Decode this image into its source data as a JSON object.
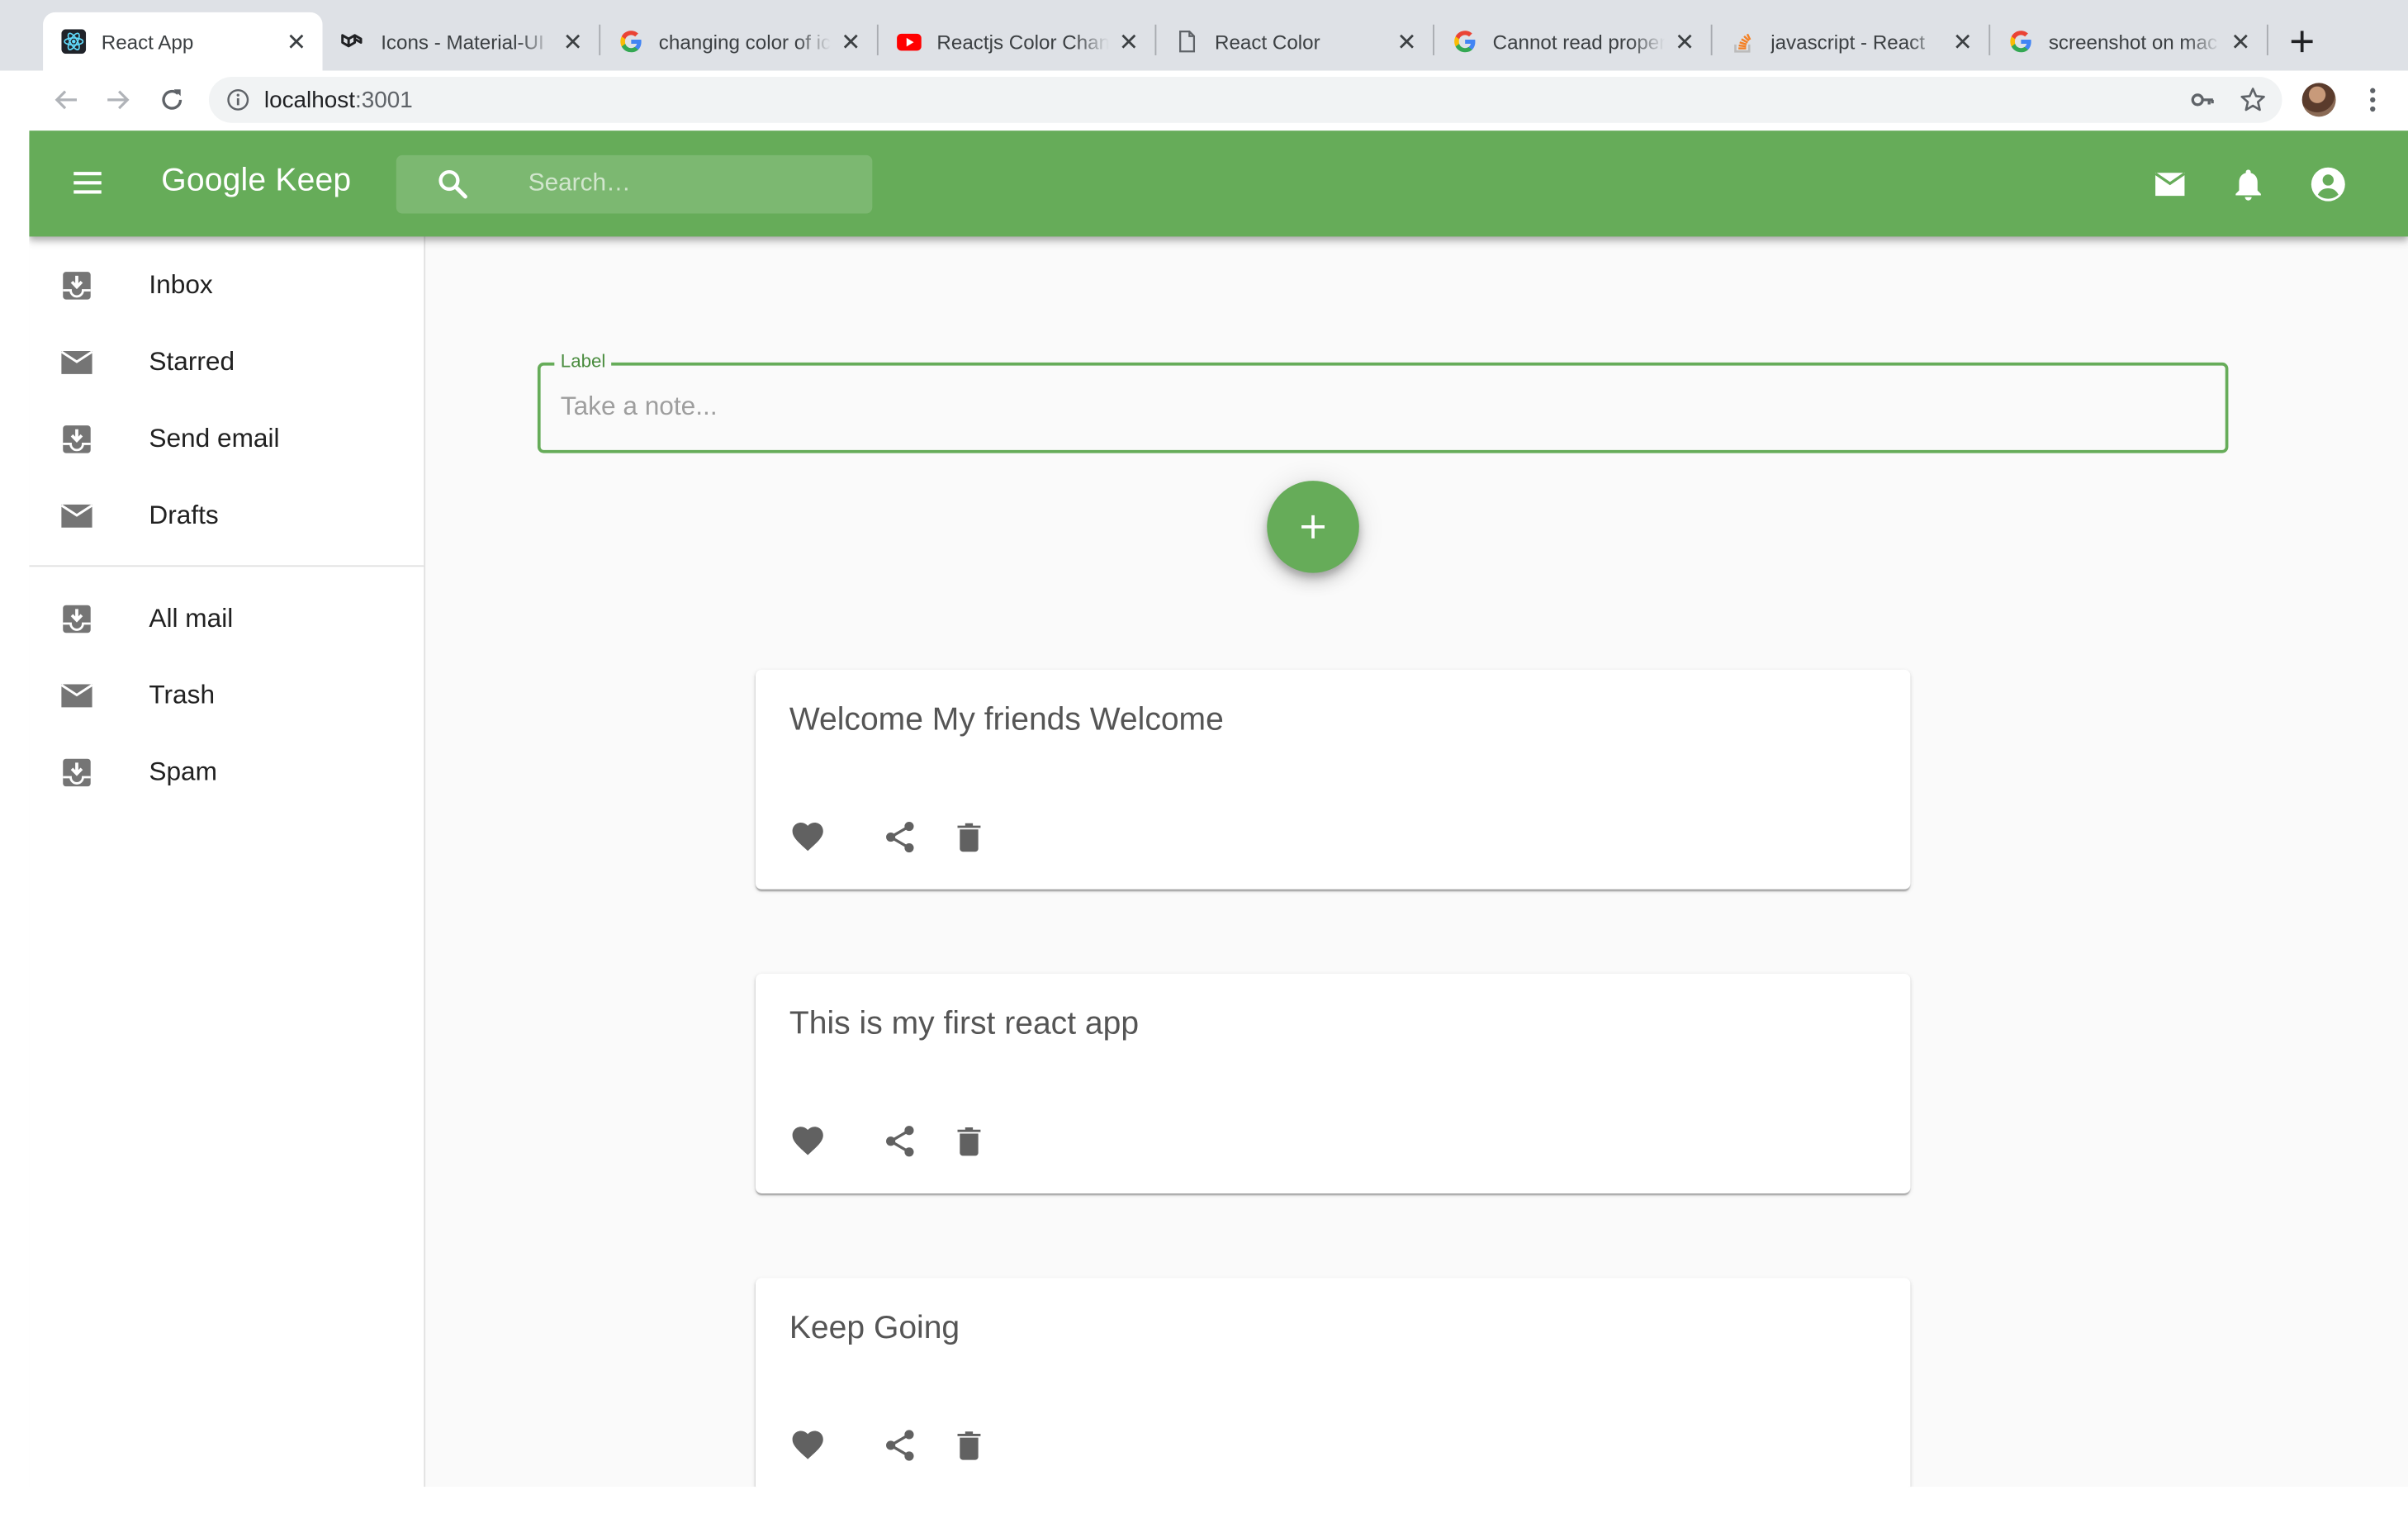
{
  "browser": {
    "tabs": [
      {
        "title": "React App",
        "icon": "react-favicon",
        "active": true
      },
      {
        "title": "Icons - Material-UI",
        "icon": "material-ui-favicon",
        "active": false
      },
      {
        "title": "changing color of icons",
        "icon": "google-favicon",
        "active": false
      },
      {
        "title": "Reactjs Color Change",
        "icon": "youtube-favicon",
        "active": false
      },
      {
        "title": "React Color",
        "icon": "document-favicon",
        "active": false
      },
      {
        "title": "Cannot read property",
        "icon": "google-favicon",
        "active": false
      },
      {
        "title": "javascript - React",
        "icon": "stackoverflow-favicon",
        "active": false
      },
      {
        "title": "screenshot on mac",
        "icon": "google-favicon",
        "active": false
      }
    ],
    "address": {
      "host": "localhost",
      "port": ":3001"
    }
  },
  "app": {
    "brand": "Google Keep",
    "search_placeholder": "Search…",
    "accent_color": "#66ac59",
    "header_icons": [
      "mail-icon",
      "notifications-icon",
      "account-circle-icon"
    ]
  },
  "drawer": {
    "primary": [
      {
        "label": "Inbox",
        "icon": "move-to-inbox-icon"
      },
      {
        "label": "Starred",
        "icon": "mail-icon"
      },
      {
        "label": "Send email",
        "icon": "move-to-inbox-icon"
      },
      {
        "label": "Drafts",
        "icon": "mail-icon"
      }
    ],
    "secondary": [
      {
        "label": "All mail",
        "icon": "move-to-inbox-icon"
      },
      {
        "label": "Trash",
        "icon": "mail-icon"
      },
      {
        "label": "Spam",
        "icon": "move-to-inbox-icon"
      }
    ]
  },
  "composer": {
    "label": "Label",
    "placeholder": "Take a note...",
    "add_icon": "add-icon"
  },
  "notes": [
    {
      "title": "Welcome My friends Welcome"
    },
    {
      "title": "This is my first react app"
    },
    {
      "title": "Keep Going"
    }
  ],
  "note_actions": [
    "favorite-icon",
    "share-icon",
    "delete-icon"
  ]
}
